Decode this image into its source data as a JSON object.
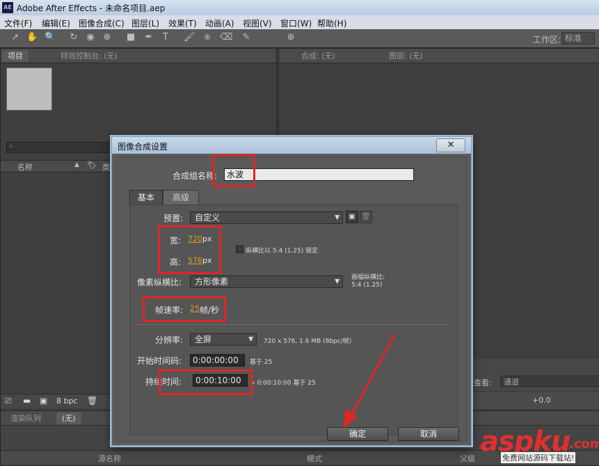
{
  "window": {
    "title": "Adobe After Effects - 未命名项目.aep",
    "logo": "AE"
  },
  "menu": [
    "文件(F)",
    "编辑(E)",
    "图像合成(C)",
    "图层(L)",
    "效果(T)",
    "动画(A)",
    "视图(V)",
    "窗口(W)",
    "帮助(H)"
  ],
  "toolbar": {
    "workspace_label": "工作区:",
    "workspace_value": "标准"
  },
  "left_panel": {
    "tabs": [
      "项目",
      "特效控制台: (无)"
    ],
    "column_name": "名称",
    "column_type": "类",
    "bpc": "8 bpc"
  },
  "right_panel": {
    "tabs": [
      "合成: (无)",
      "图层: (无)"
    ],
    "view_label": "查看:",
    "view_value": "通道",
    "timecode": "+0.0"
  },
  "bottom_panel": {
    "tabs": [
      "渲染队列",
      "(无)"
    ],
    "source_name_col": "源名称",
    "mode_col": "模式",
    "parent_col": "父级"
  },
  "dialog": {
    "title": "图像合成设置",
    "close": "✕",
    "comp_name_label": "合成组名称:",
    "comp_name_value": "水波",
    "tabs": [
      "基本",
      "高级"
    ],
    "preset_label": "预置:",
    "preset_value": "自定义",
    "width_label": "宽:",
    "width_value": "720",
    "height_label": "高:",
    "height_value": "576",
    "unit_px": "px",
    "lock_aspect_label": "纵横比以 5:4 (1.25) 锁定",
    "pixel_aspect_label": "像素纵横比:",
    "pixel_aspect_value": "方形像素",
    "frame_aspect_label": "画幅纵横比:",
    "frame_aspect_value": "5:4 (1.25)",
    "frame_rate_label": "帧速率:",
    "frame_rate_value": "25",
    "frame_rate_unit": "帧/秒",
    "resolution_label": "分辨率:",
    "resolution_value": "全屏",
    "resolution_info": "720 x 576, 1.6 MB (8bpc/帧)",
    "start_tc_label": "开始时间码:",
    "start_tc_value": "0:00:00:00",
    "start_tc_base": "基于 25",
    "duration_label": "持续时间:",
    "duration_value": "0:00:10:00",
    "duration_info": "= 0:00:10:00  基于 25",
    "ok": "确定",
    "cancel": "取消"
  },
  "watermark": {
    "brand": "aspku",
    "tld": ".com",
    "sub": "免费网站源码下载站!"
  },
  "colors": {
    "highlight": "#e02626",
    "value_orange": "#e09a2a"
  }
}
